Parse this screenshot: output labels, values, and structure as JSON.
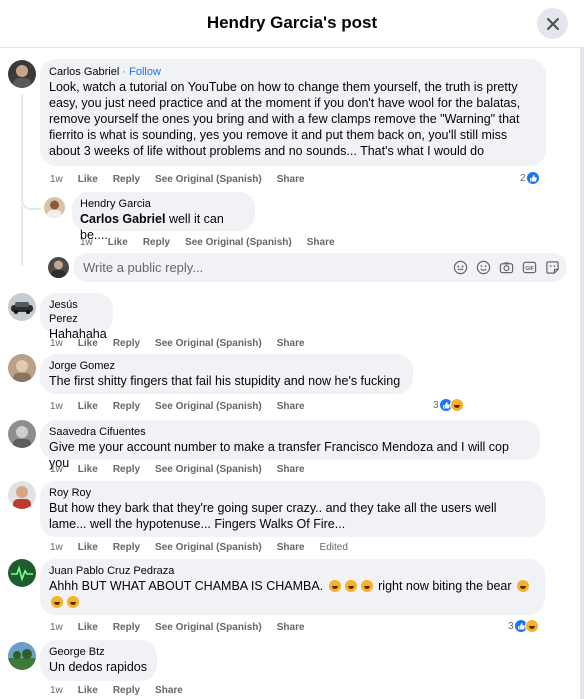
{
  "header": {
    "title": "Hendry Garcia's post"
  },
  "reply_box": {
    "placeholder": "Write a public reply..."
  },
  "comments": [
    {
      "author": "Carlos Gabriel",
      "follow": "Follow",
      "text": "Look, watch a tutorial on YouTube on how to change them yourself, the truth is pretty easy, you just need practice and at the moment if you don't have wool for the balatas, remove yourself the ones you bring and with a few clamps remove the \"Warning\" that fierrito is what is sounding, yes you remove it and put them back on, you'll still miss about 3 weeks of life without problems and no sounds... That's what I would do",
      "time": "1w",
      "like": "Like",
      "reply": "Reply",
      "see_original": "See Original (Spanish)",
      "share": "Share",
      "reaction_count": "2"
    },
    {
      "author": "Hendry Garcia",
      "mention": "Carlos Gabriel",
      "text": "well it can be....",
      "time": "1w",
      "like": "Like",
      "reply": "Reply",
      "see_original": "See Original (Spanish)",
      "share": "Share"
    },
    {
      "author": "Jesús Perez",
      "text": "Hahahaha",
      "time": "1w",
      "like": "Like",
      "reply": "Reply",
      "see_original": "See Original (Spanish)",
      "share": "Share"
    },
    {
      "author": "Jorge Gomez",
      "text": "The first shitty fingers that fail his stupidity and now he's fucking",
      "time": "1w",
      "like": "Like",
      "reply": "Reply",
      "see_original": "See Original (Spanish)",
      "share": "Share",
      "reaction_count": "3"
    },
    {
      "author": "Saavedra Cifuentes",
      "text": "Give me your account number to make a transfer Francisco Mendoza and I will cop you",
      "time": "1w",
      "like": "Like",
      "reply": "Reply",
      "see_original": "See Original (Spanish)",
      "share": "Share"
    },
    {
      "author": "Roy Roy",
      "text": "But how they bark that they're going super crazy.. and they take all the users well lame... well the hypotenuse... Fingers Walks Of Fire...",
      "time": "1w",
      "like": "Like",
      "reply": "Reply",
      "see_original": "See Original (Spanish)",
      "share": "Share",
      "edited": "Edited"
    },
    {
      "author": "Juan Pablo Cruz Pedraza",
      "text_a": "Ahhh BUT WHAT ABOUT CHAMBA IS CHAMBA.",
      "text_b": "right now biting the bear",
      "time": "1w",
      "like": "Like",
      "reply": "Reply",
      "see_original": "See Original (Spanish)",
      "share": "Share",
      "reaction_count": "3"
    },
    {
      "author": "George Btz",
      "text": "Un dedos rapidos",
      "time": "1w",
      "like": "Like",
      "reply": "Reply",
      "share": "Share"
    }
  ],
  "icons": [
    "close-icon",
    "like-reaction-icon",
    "haha-reaction-icon",
    "sticker-icon",
    "emoji-icon",
    "camera-icon",
    "gif-icon",
    "avatar-sticker-icon"
  ],
  "colors": {
    "accent": "#1877f2",
    "bubble": "#f0f2f5",
    "muted": "#65676b"
  }
}
